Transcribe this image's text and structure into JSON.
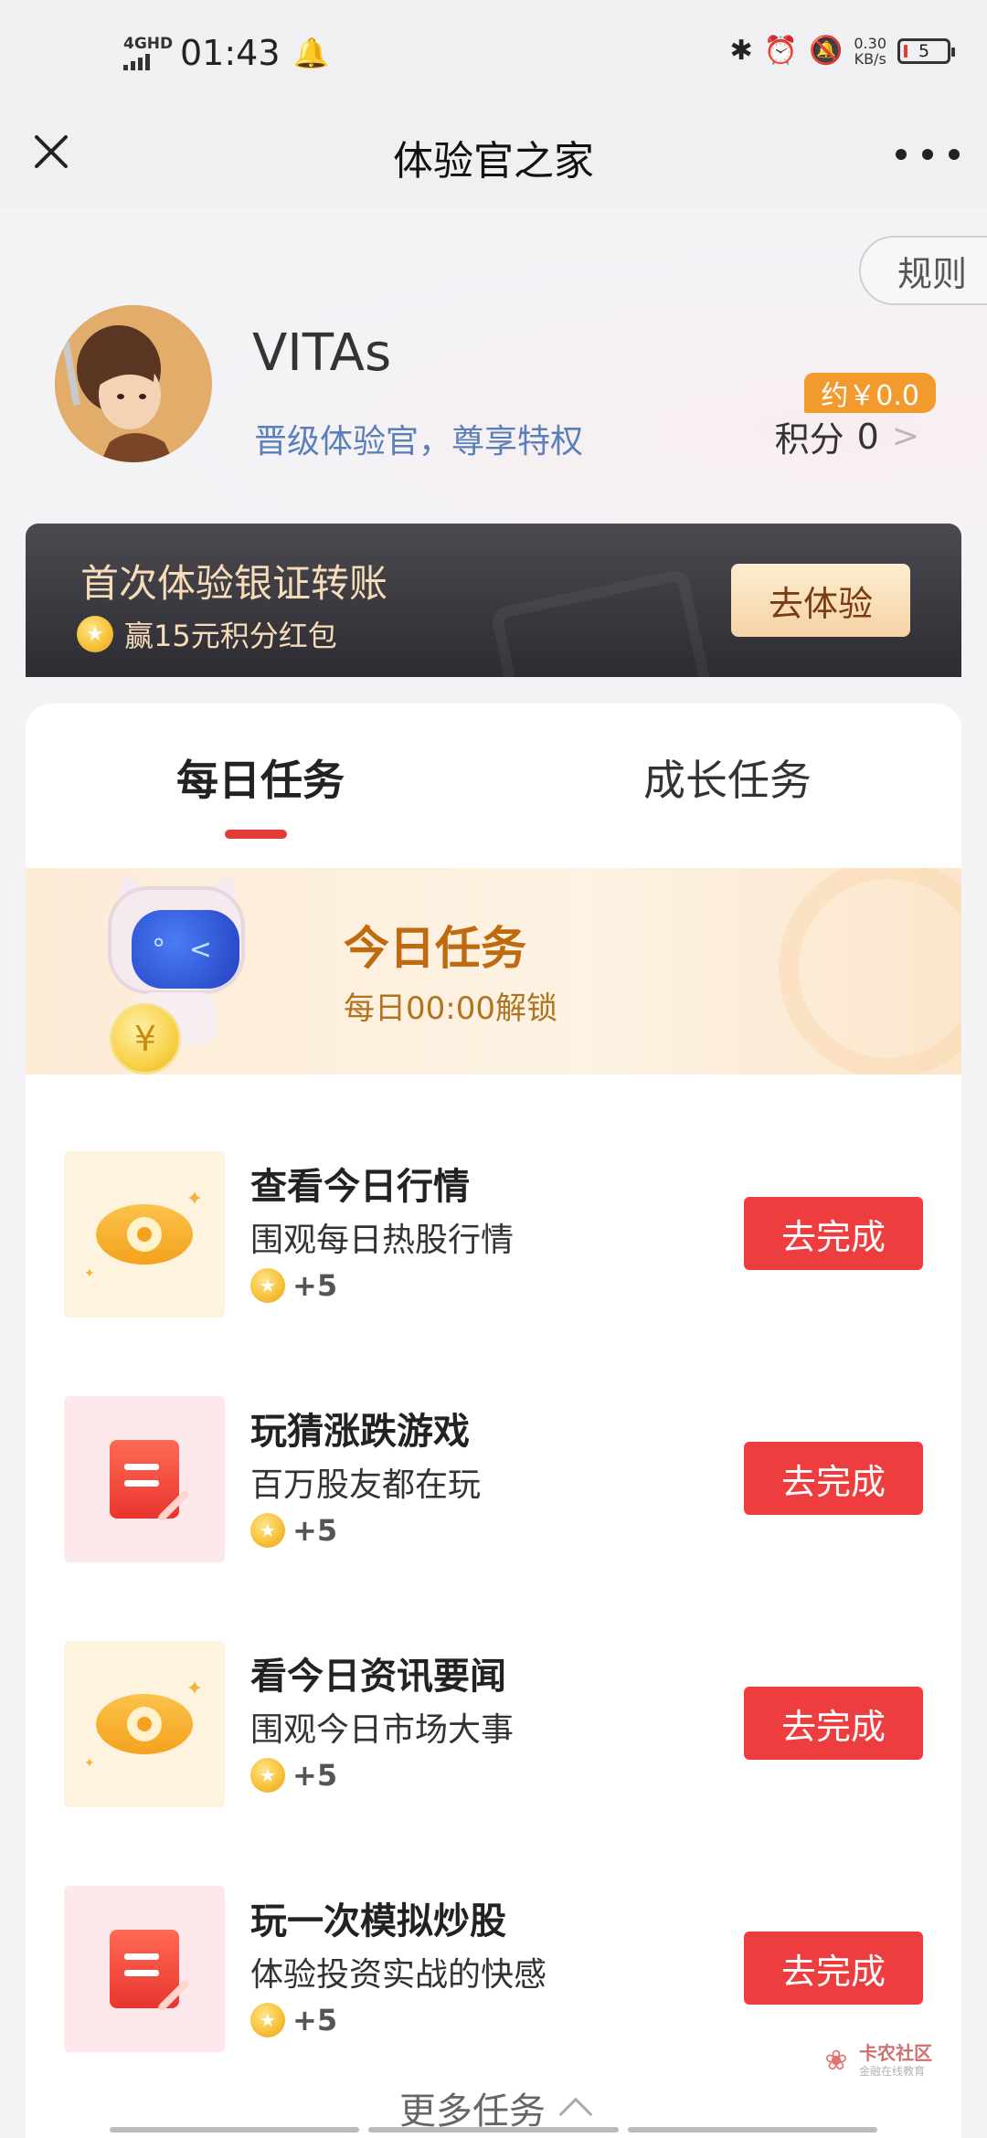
{
  "status_bar": {
    "network": "4GHD",
    "time": "01:43",
    "speed_value": "0.30",
    "speed_unit": "KB/s",
    "battery": "5"
  },
  "nav": {
    "title": "体验官之家",
    "close_icon": "close-icon",
    "more_icon": "more-dots-icon"
  },
  "profile": {
    "rules_label": "规则",
    "username": "VITAs",
    "upgrade_text": "晋级体验官，尊享特权",
    "points_value_badge": "约￥0.0",
    "points_label": "积分",
    "points_value": "0",
    "points_chevron": ">"
  },
  "promo": {
    "title": "首次体验银证转账",
    "subtitle": "赢15元积分红包",
    "button_label": "去体验"
  },
  "tabs": [
    {
      "label": "每日任务",
      "active": true
    },
    {
      "label": "成长任务",
      "active": false
    }
  ],
  "today": {
    "title": "今日任务",
    "subtitle": "每日00:00解锁",
    "coin_symbol": "¥"
  },
  "tasks": [
    {
      "icon": "eye-icon",
      "title": "查看今日行情",
      "desc": "围观每日热股行情",
      "reward": "+5",
      "button": "去完成"
    },
    {
      "icon": "document-icon",
      "title": "玩猜涨跌游戏",
      "desc": "百万股友都在玩",
      "reward": "+5",
      "button": "去完成"
    },
    {
      "icon": "eye-icon",
      "title": "看今日资讯要闻",
      "desc": "围观今日市场大事",
      "reward": "+5",
      "button": "去完成"
    },
    {
      "icon": "document-icon",
      "title": "玩一次模拟炒股",
      "desc": "体验投资实战的快感",
      "reward": "+5",
      "button": "去完成"
    }
  ],
  "more_tasks_label": "更多任务",
  "watermark": {
    "name": "卡农社区",
    "sub": "金融在线教育"
  },
  "colors": {
    "accent_red": "#ee3d3f",
    "link_blue": "#5b7fb8",
    "badge_orange": "#f39a2e",
    "today_title": "#c06a10"
  }
}
